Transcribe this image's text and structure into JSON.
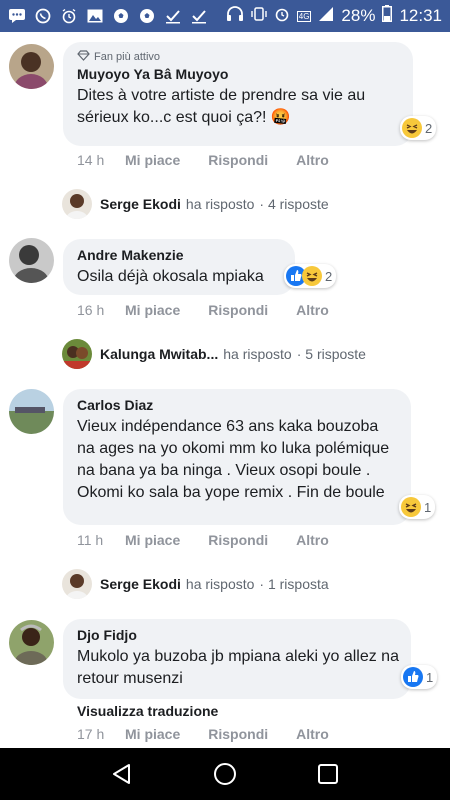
{
  "status_bar": {
    "icons": [
      "messages-icon",
      "whatsapp-icon",
      "alarm-icon",
      "image-icon",
      "soccer-icon",
      "soccer-icon",
      "check-icon",
      "check-icon"
    ],
    "battery": "28%",
    "time": "12:31",
    "network": "4G"
  },
  "comments": [
    {
      "badge": "Fan più attivo",
      "author": "Muyoyo Ya Bâ Muyoyo",
      "text": "Dites à votre artiste de prendre sa vie au sérieux ko...c est quoi ça?! 🤬",
      "reaction_count": "2",
      "time": "14 h",
      "like": "Mi piace",
      "reply": "Rispondi",
      "more": "Altro",
      "replies": {
        "name": "Serge Ekodi",
        "action": "ha risposto",
        "count": "· 4 risposte"
      }
    },
    {
      "author": "Andre Makenzie",
      "text": "Osila déjà okosala mpiaka",
      "reaction_count": "2",
      "time": "16 h",
      "like": "Mi piace",
      "reply": "Rispondi",
      "more": "Altro",
      "replies": {
        "name": "Kalunga Mwitab...",
        "action": "ha risposto",
        "count": "· 5 risposte"
      }
    },
    {
      "author": "Carlos Diaz",
      "text": "Vieux indépendance 63 ans kaka bouzoba na ages na yo okomi mm ko luka polémique na bana ya ba ninga . Vieux osopi boule . Okomi ko sala ba yope remix . Fin de boule",
      "reaction_count": "1",
      "time": "11 h",
      "like": "Mi piace",
      "reply": "Rispondi",
      "more": "Altro",
      "replies": {
        "name": "Serge Ekodi",
        "action": "ha risposto",
        "count": "· 1 risposta"
      }
    },
    {
      "author": "Djo Fidjo",
      "text": "Mukolo ya buzoba jb mpiana aleki yo allez na retour musenzi",
      "reaction_count": "1",
      "translate": "Visualizza traduzione",
      "time": "17 h",
      "like": "Mi piace",
      "reply": "Rispondi",
      "more": "Altro"
    }
  ],
  "colors": {
    "statusbar": "#3b5998",
    "bubble": "#f0f2f5",
    "muted": "#90949c",
    "like_blue": "#1877f2"
  }
}
